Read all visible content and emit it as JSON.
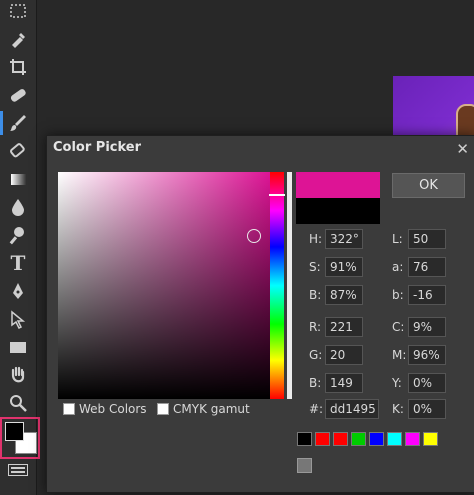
{
  "toolbar": {
    "tools": [
      {
        "name": "marquee-icon"
      },
      {
        "name": "brush-picker-icon"
      },
      {
        "name": "crop-icon"
      },
      {
        "name": "healing-icon"
      },
      {
        "name": "brush-icon",
        "active": true
      },
      {
        "name": "eraser-icon"
      },
      {
        "name": "gradient-icon"
      },
      {
        "name": "blur-drop-icon"
      },
      {
        "name": "dodge-icon"
      },
      {
        "name": "text-icon",
        "glyph": "T"
      },
      {
        "name": "pen-icon"
      },
      {
        "name": "path-select-icon"
      },
      {
        "name": "rectangle-icon"
      },
      {
        "name": "hand-icon"
      },
      {
        "name": "zoom-icon"
      }
    ],
    "foreground_color": "#000000",
    "background_color": "#ffffff"
  },
  "dialog": {
    "title": "Color Picker",
    "close_glyph": "✕",
    "ok_label": "OK",
    "new_color": "#dd1495",
    "old_color": "#000000",
    "fields_left": [
      {
        "label": "H:",
        "value": "322°"
      },
      {
        "label": "S:",
        "value": "91%"
      },
      {
        "label": "B:",
        "value": "87%"
      },
      {
        "label": "R:",
        "value": "221"
      },
      {
        "label": "G:",
        "value": "20"
      },
      {
        "label": "B:",
        "value": "149"
      },
      {
        "label": "#:",
        "value": "dd1495"
      }
    ],
    "fields_right": [
      {
        "label": "L:",
        "value": "50"
      },
      {
        "label": "a:",
        "value": "76"
      },
      {
        "label": "b:",
        "value": "-16"
      },
      {
        "label": "C:",
        "value": "9%"
      },
      {
        "label": "M:",
        "value": "96%"
      },
      {
        "label": "Y:",
        "value": "0%"
      },
      {
        "label": "K:",
        "value": "0%"
      }
    ],
    "web_colors_label": "Web Colors",
    "cmyk_gamut_label": "CMYK gamut",
    "swatches": [
      "#000000",
      "#ff0000",
      "#ff0000",
      "#00cc00",
      "#0000ff",
      "#00ffff",
      "#ff00ff",
      "#ffff00"
    ],
    "extra_swatch": "#777777"
  }
}
